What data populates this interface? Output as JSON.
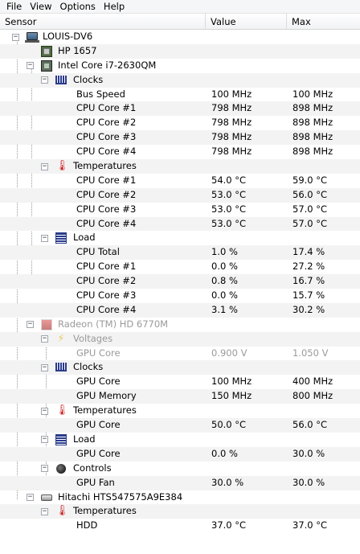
{
  "menu": [
    "File",
    "View",
    "Options",
    "Help"
  ],
  "columns": {
    "sensor": "Sensor",
    "value": "Value",
    "max": "Max"
  },
  "rows": [
    {
      "label": "LOUIS-DV6",
      "value": "",
      "max": ""
    },
    {
      "label": "HP 1657",
      "value": "",
      "max": ""
    },
    {
      "label": "Intel Core i7-2630QM",
      "value": "",
      "max": ""
    },
    {
      "label": "Clocks",
      "value": "",
      "max": ""
    },
    {
      "label": "Bus Speed",
      "value": "100 MHz",
      "max": "100 MHz"
    },
    {
      "label": "CPU Core #1",
      "value": "798 MHz",
      "max": "898 MHz"
    },
    {
      "label": "CPU Core #2",
      "value": "798 MHz",
      "max": "898 MHz"
    },
    {
      "label": "CPU Core #3",
      "value": "798 MHz",
      "max": "898 MHz"
    },
    {
      "label": "CPU Core #4",
      "value": "798 MHz",
      "max": "898 MHz"
    },
    {
      "label": "Temperatures",
      "value": "",
      "max": ""
    },
    {
      "label": "CPU Core #1",
      "value": "54.0 °C",
      "max": "59.0 °C"
    },
    {
      "label": "CPU Core #2",
      "value": "53.0 °C",
      "max": "56.0 °C"
    },
    {
      "label": "CPU Core #3",
      "value": "53.0 °C",
      "max": "57.0 °C"
    },
    {
      "label": "CPU Core #4",
      "value": "53.0 °C",
      "max": "57.0 °C"
    },
    {
      "label": "Load",
      "value": "",
      "max": ""
    },
    {
      "label": "CPU Total",
      "value": "1.0 %",
      "max": "17.4 %"
    },
    {
      "label": "CPU Core #1",
      "value": "0.0 %",
      "max": "27.2 %"
    },
    {
      "label": "CPU Core #2",
      "value": "0.8 %",
      "max": "16.7 %"
    },
    {
      "label": "CPU Core #3",
      "value": "0.0 %",
      "max": "15.7 %"
    },
    {
      "label": "CPU Core #4",
      "value": "3.1 %",
      "max": "30.2 %"
    },
    {
      "label": "Radeon (TM) HD 6770M",
      "value": "",
      "max": ""
    },
    {
      "label": "Voltages",
      "value": "",
      "max": ""
    },
    {
      "label": "GPU Core",
      "value": "0.900 V",
      "max": "1.050 V"
    },
    {
      "label": "Clocks",
      "value": "",
      "max": ""
    },
    {
      "label": "GPU Core",
      "value": "100 MHz",
      "max": "400 MHz"
    },
    {
      "label": "GPU Memory",
      "value": "150 MHz",
      "max": "800 MHz"
    },
    {
      "label": "Temperatures",
      "value": "",
      "max": ""
    },
    {
      "label": "GPU Core",
      "value": "50.0 °C",
      "max": "56.0 °C"
    },
    {
      "label": "Load",
      "value": "",
      "max": ""
    },
    {
      "label": "GPU Core",
      "value": "0.0 %",
      "max": "30.0 %"
    },
    {
      "label": "Controls",
      "value": "",
      "max": ""
    },
    {
      "label": "GPU Fan",
      "value": "30.0 %",
      "max": "30.0 %"
    },
    {
      "label": "Hitachi HTS547575A9E384",
      "value": "",
      "max": ""
    },
    {
      "label": "Temperatures",
      "value": "",
      "max": ""
    },
    {
      "label": "HDD",
      "value": "37.0 °C",
      "max": "37.0 °C"
    }
  ],
  "icons": {
    "computer": "laptop-icon",
    "mainboard": "mainboard-icon",
    "cpu": "cpu-icon",
    "gpu": "gpu-icon",
    "hdd": "hdd-icon",
    "clocks": "clocks-icon",
    "temperatures": "thermometer-icon",
    "load": "load-icon",
    "voltages": "voltage-icon",
    "controls": "fan-icon"
  },
  "colors": {
    "accent_temperature": "#cc1a1a",
    "disabled_text": "#9a9a9a",
    "alt_row": "#f3f3f3"
  }
}
